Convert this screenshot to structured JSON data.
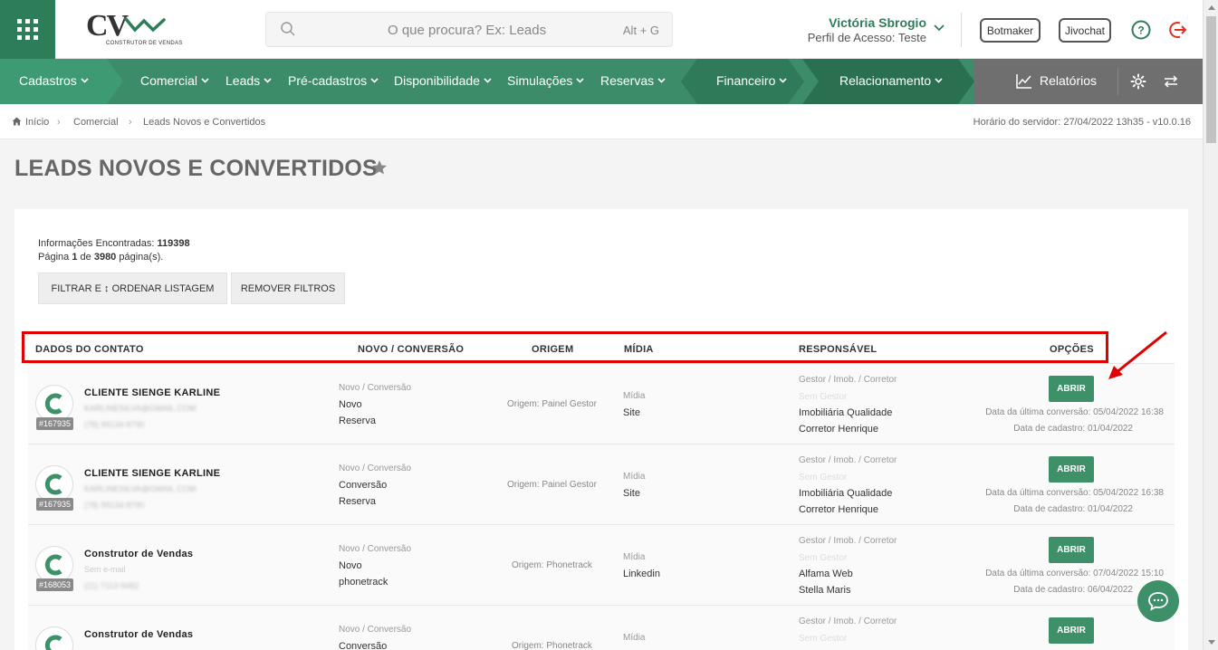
{
  "header": {
    "logo_text": "CV",
    "logo_sub": "CONSTRUTOR DE VENDAS",
    "search_placeholder": "O que procura? Ex: Leads",
    "search_shortcut": "Alt + G",
    "user_name": "Victória Sbrogio",
    "user_role": "Perfil de Acesso: Teste",
    "botmaker_label": "Botmaker",
    "jivochat_label": "Jivochat"
  },
  "nav": {
    "items": [
      "Cadastros",
      "Comercial",
      "Leads",
      "Pré-cadastros",
      "Disponibilidade",
      "Simulações",
      "Reservas",
      "Financeiro",
      "Relacionamento"
    ],
    "reports": "Relatórios"
  },
  "breadcrumb": {
    "home": "Início",
    "level1": "Comercial",
    "level2": "Leads Novos e Convertidos",
    "server_time": "Horário do servidor: 27/04/2022 13h35 - v10.0.16"
  },
  "page": {
    "title": "LEADS NOVOS E CONVERTIDOS",
    "found_label": "Informações Encontradas:",
    "found_count": "119398",
    "page_prefix": "Página",
    "page_current": "1",
    "page_of": "de",
    "page_total": "3980",
    "page_suffix": "página(s).",
    "filter_button": "FILTRAR E ↕ ORDENAR LISTAGEM",
    "remove_filters_button": "REMOVER FILTROS"
  },
  "table": {
    "headers": [
      "DADOS DO CONTATO",
      "NOVO / CONVERSÃO",
      "ORIGEM",
      "MÍDIA",
      "RESPONSÁVEL",
      "OPÇÕES"
    ],
    "labels": {
      "novo_conversao": "Novo / Conversão",
      "midia": "Mídia",
      "responsavel": "Gestor / Imob. / Corretor",
      "sem_gestor": "Sem Gestor",
      "abrir": "ABRIR"
    },
    "rows": [
      {
        "name": "CLIENTE SIENGE KARLINE",
        "email": "KARLINESILVA@GMAIL.COM",
        "phone": "(78) 99134-8790",
        "id": "#167935",
        "status": "Novo",
        "sub": "Reserva",
        "origin": "Origem: Painel Gestor",
        "media": "Site",
        "imob": "Imobiliária Qualidade",
        "broker": "Corretor Henrique",
        "last_conv": "Data da última conversão: 05/04/2022 16:38",
        "created": "Data de cadastro: 01/04/2022"
      },
      {
        "name": "CLIENTE SIENGE KARLINE",
        "email": "KARLINESILVA@GMAIL.COM",
        "phone": "(78) 99134-8790",
        "id": "#167935",
        "status": "Conversão",
        "sub": "Reserva",
        "origin": "Origem: Painel Gestor",
        "media": "Site",
        "imob": "Imobiliária Qualidade",
        "broker": "Corretor Henrique",
        "last_conv": "Data da última conversão: 05/04/2022 16:38",
        "created": "Data de cadastro: 01/04/2022"
      },
      {
        "name": "Construtor de Vendas",
        "email": "Sem e-mail",
        "phone": "(11) 7113-9482",
        "id": "#168053",
        "status": "Novo",
        "sub": "phonetrack",
        "origin": "Origem: Phonetrack",
        "media": "Linkedin",
        "imob": "Alfama Web",
        "broker": "Stella Maris",
        "last_conv": "Data da última conversão: 07/04/2022 15:10",
        "created": "Data de cadastro: 06/04/2022"
      },
      {
        "name": "Construtor de Vendas",
        "email": "",
        "phone": "",
        "id": "",
        "status": "Conversão",
        "sub": "",
        "origin": "Origem: Phonetrack",
        "media": "",
        "imob": "",
        "broker": "",
        "last_conv": "",
        "created": ""
      }
    ]
  }
}
